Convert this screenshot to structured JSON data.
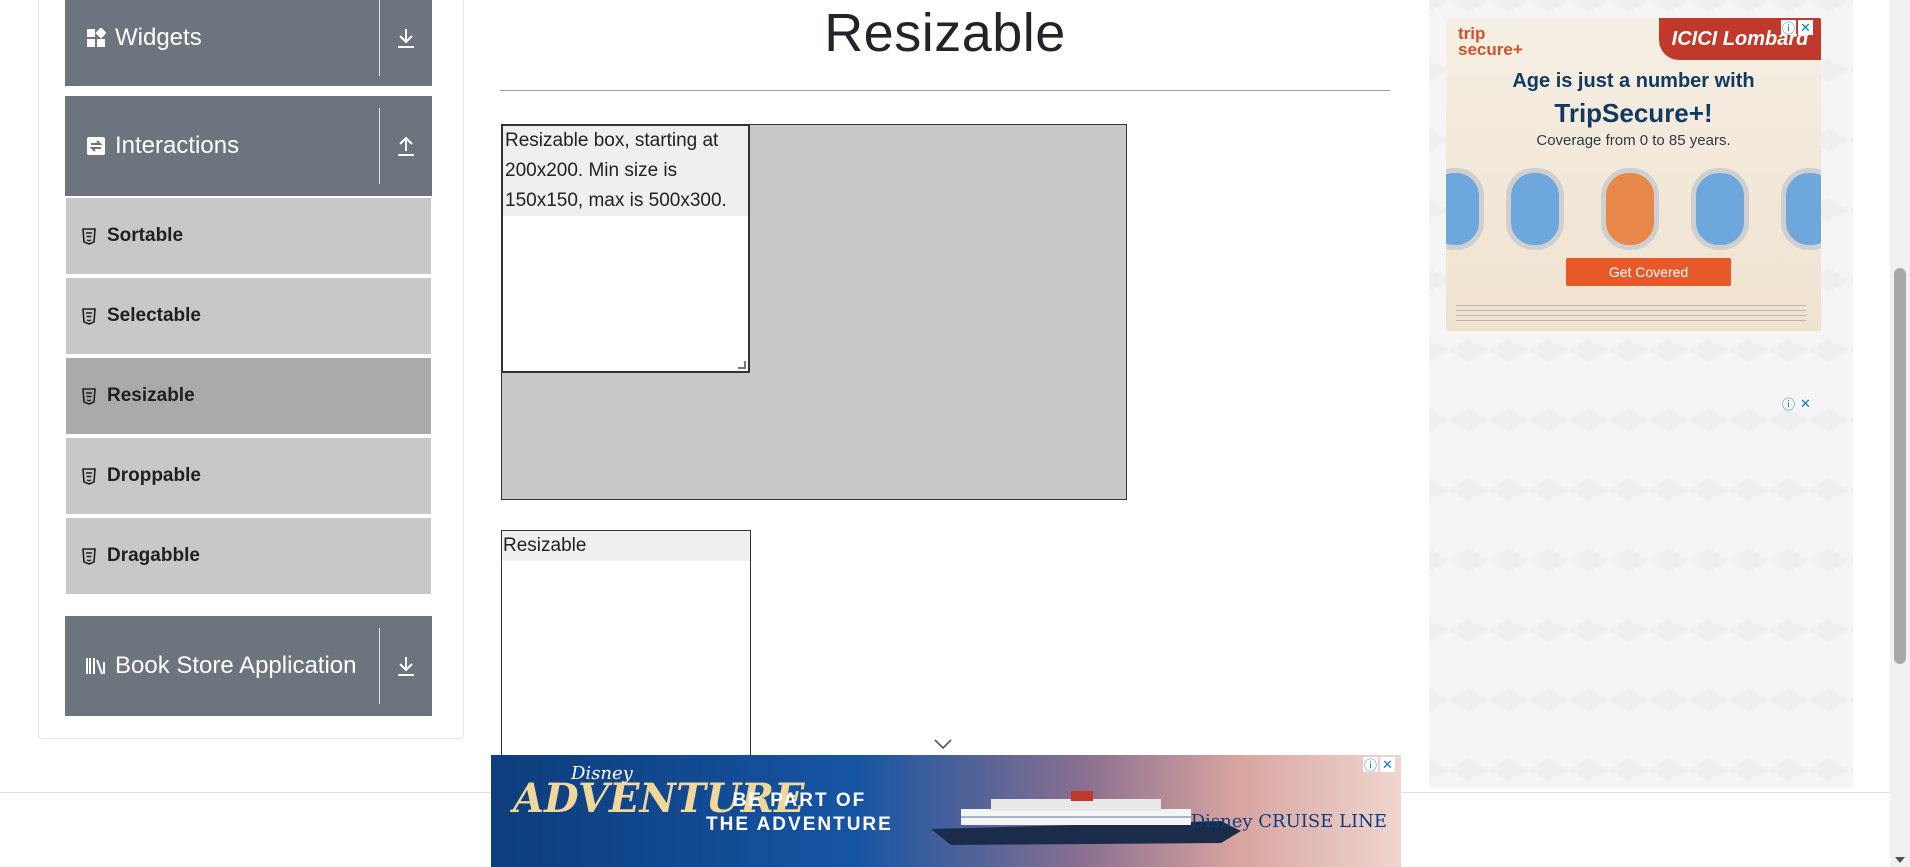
{
  "sidebar": {
    "groups": [
      {
        "label": "Widgets",
        "icon": "widgets-icon",
        "toggle": "download-icon"
      },
      {
        "label": "Interactions",
        "icon": "interactions-icon",
        "toggle": "upload-icon"
      },
      {
        "label": "Book Store Application",
        "icon": "book-store-icon",
        "toggle": "download-icon"
      }
    ],
    "items": [
      {
        "label": "Sortable"
      },
      {
        "label": "Selectable"
      },
      {
        "label": "Resizable",
        "active": true
      },
      {
        "label": "Droppable"
      },
      {
        "label": "Dragabble"
      }
    ]
  },
  "main": {
    "title": "Resizable",
    "restricted_box_text": "Resizable box, starting at 200x200. Min size is 150x150, max is 500x300.",
    "free_box_text": "Resizable"
  },
  "ads": {
    "top": {
      "brand_left": "trip secure+",
      "brand_right": "ICICI Lombard",
      "headline": "Age is just a number with",
      "product": "TripSecure+!",
      "subline": "Coverage from 0 to 85 years.",
      "cta": "Get Covered"
    },
    "bottom": {
      "brand_small": "Disney",
      "brand": "ADVENTURE",
      "cta_line1": "BE PART OF",
      "cta_line2": "THE ADVENTURE",
      "cruise_line": "Disney CRUISE LINE"
    }
  },
  "colors": {
    "sidebar_header": "#6c757d",
    "menu_item": "#c8c8c8",
    "menu_item_active": "#aaaaaa",
    "constraint_area": "#c8c8c8"
  }
}
